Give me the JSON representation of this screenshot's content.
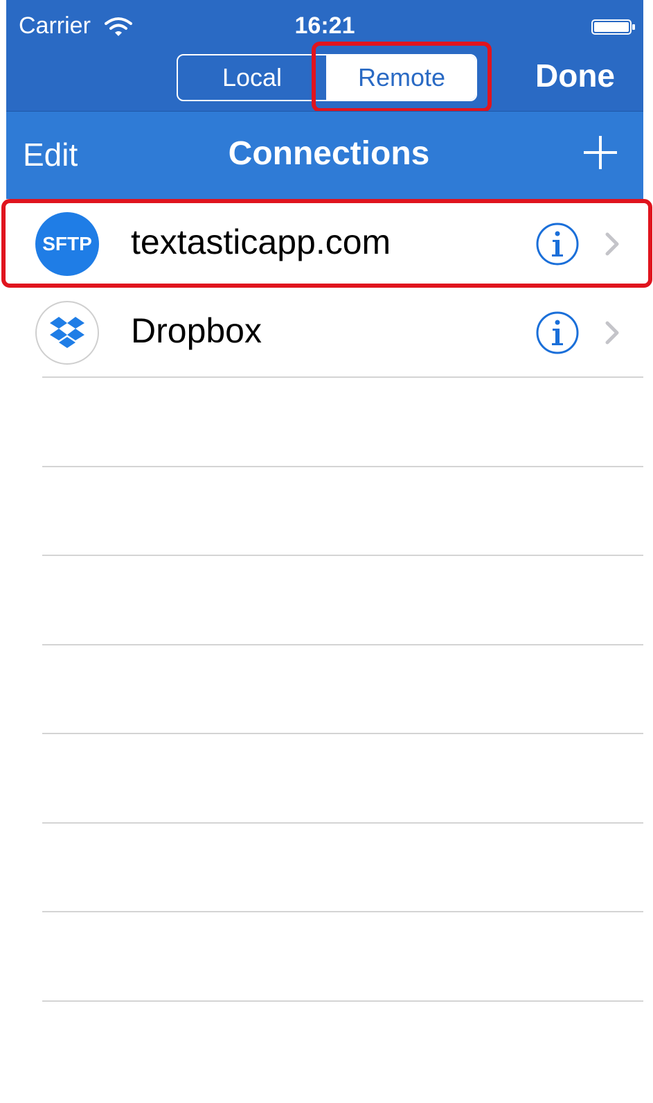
{
  "status_bar": {
    "carrier": "Carrier",
    "time": "16:21"
  },
  "segmented_control": {
    "options": [
      "Local",
      "Remote"
    ],
    "selected": "Remote"
  },
  "done_label": "Done",
  "navbar": {
    "edit_label": "Edit",
    "title": "Connections"
  },
  "connections": [
    {
      "badge": "SFTP",
      "name": "textasticapp.com",
      "icon": "sftp-icon"
    },
    {
      "badge": "",
      "name": "Dropbox",
      "icon": "dropbox-icon"
    }
  ],
  "colors": {
    "topbar": "#2a6ac4",
    "navbar": "#2f7bd6",
    "highlight": "#e0141e",
    "sftp_badge": "#1f7de6",
    "info_icon": "#1a6fd9"
  },
  "icons": [
    "wifi-icon",
    "battery-icon",
    "plus-icon",
    "sftp-icon",
    "dropbox-icon",
    "info-icon",
    "chevron-right-icon"
  ]
}
